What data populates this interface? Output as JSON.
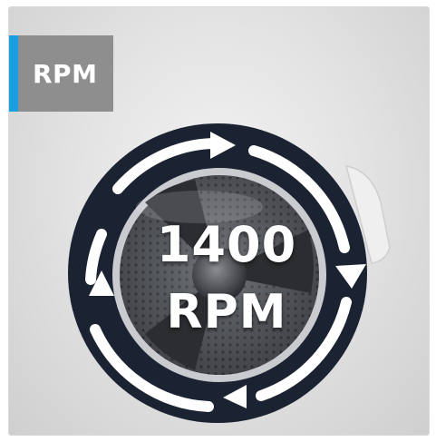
{
  "badge": {
    "label": "RPM"
  },
  "feature": {
    "value": "1400",
    "unit": "RPM"
  },
  "colors": {
    "accent": "#1a9ee0",
    "badge_bg": "#8e8e8e",
    "ring": "#1b2333",
    "arrow": "#ffffff"
  },
  "icons": [
    "rotation-arrows-icon",
    "washing-drum-icon"
  ]
}
